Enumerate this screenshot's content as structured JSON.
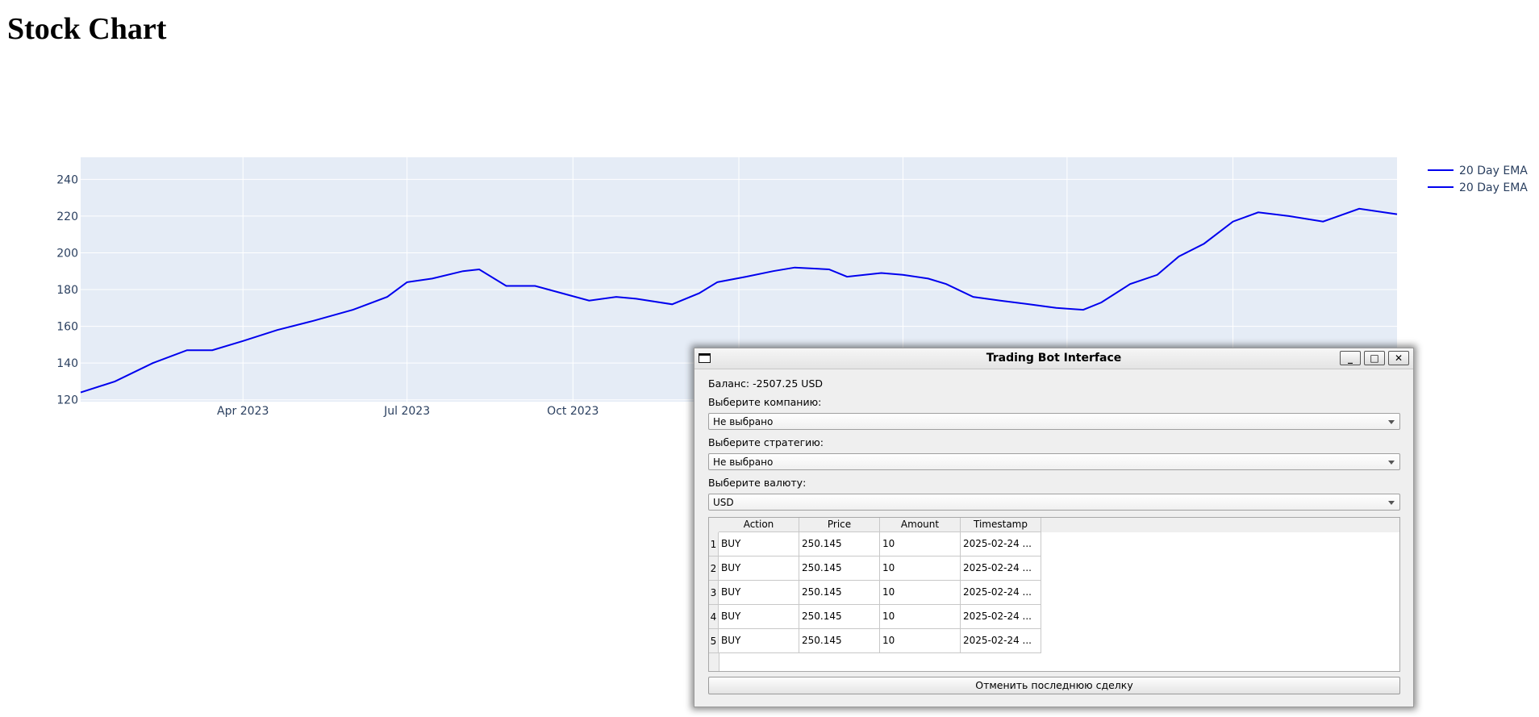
{
  "page": {
    "title": "Stock Chart"
  },
  "chart_data": {
    "type": "line",
    "legend": {
      "entries": [
        "20 Day EMA",
        "20 Day EMA"
      ],
      "placement": "top-right"
    },
    "x_ticks": [
      "Apr 2023",
      "Jul 2023",
      "Oct 2023"
    ],
    "y_ticks": [
      120,
      140,
      160,
      180,
      200,
      220,
      240
    ],
    "ylim": [
      119,
      252
    ],
    "xlim": [
      "2023-01-01",
      "2024-12-31"
    ],
    "grid": true,
    "colors": {
      "line": "#0000ee",
      "plot_bg": "#e5ecf6",
      "grid": "#ffffff",
      "tick_text": "#2a3f5f"
    },
    "series": [
      {
        "name": "20 Day EMA",
        "x": [
          "2023-01-01",
          "2023-01-20",
          "2023-02-10",
          "2023-03-01",
          "2023-03-15",
          "2023-04-01",
          "2023-04-20",
          "2023-05-10",
          "2023-06-01",
          "2023-06-20",
          "2023-07-01",
          "2023-07-15",
          "2023-08-01",
          "2023-08-10",
          "2023-08-25",
          "2023-09-10",
          "2023-09-25",
          "2023-10-10",
          "2023-10-25",
          "2023-11-05",
          "2023-11-25",
          "2023-12-10",
          "2023-12-20",
          "2024-01-05",
          "2024-01-20",
          "2024-02-01",
          "2024-02-20",
          "2024-03-01",
          "2024-03-20",
          "2024-04-01",
          "2024-04-15",
          "2024-04-25",
          "2024-05-10",
          "2024-05-25",
          "2024-06-10",
          "2024-06-25",
          "2024-07-10",
          "2024-07-20",
          "2024-08-05",
          "2024-08-20",
          "2024-09-01",
          "2024-09-15",
          "2024-10-01",
          "2024-10-15",
          "2024-11-01",
          "2024-11-20",
          "2024-12-10",
          "2024-12-31"
        ],
        "y": [
          124,
          130,
          140,
          147,
          147,
          152,
          158,
          163,
          169,
          176,
          184,
          186,
          190,
          191,
          182,
          182,
          178,
          174,
          176,
          175,
          172,
          178,
          184,
          187,
          190,
          192,
          191,
          187,
          189,
          188,
          186,
          183,
          176,
          174,
          172,
          170,
          169,
          173,
          183,
          188,
          198,
          205,
          217,
          222,
          220,
          217,
          224,
          221
        ]
      }
    ]
  },
  "window": {
    "title": "Trading Bot Interface",
    "buttons": {
      "minimize": "_",
      "maximize": "□",
      "close": "✕"
    },
    "balance": "Баланс: -2507.25 USD",
    "company_label": "Выберите компанию:",
    "company_value": "Не выбрано",
    "strategy_label": "Выберите стратегию:",
    "strategy_value": "Не выбрано",
    "currency_label": "Выберите валюту:",
    "currency_value": "USD",
    "table": {
      "headers": [
        "Action",
        "Price",
        "Amount",
        "Timestamp"
      ],
      "rows": [
        {
          "index": "1",
          "action": "BUY",
          "price": "250.145",
          "amount": "10",
          "timestamp": "2025-02-24 ..."
        },
        {
          "index": "2",
          "action": "BUY",
          "price": "250.145",
          "amount": "10",
          "timestamp": "2025-02-24 ..."
        },
        {
          "index": "3",
          "action": "BUY",
          "price": "250.145",
          "amount": "10",
          "timestamp": "2025-02-24 ..."
        },
        {
          "index": "4",
          "action": "BUY",
          "price": "250.145",
          "amount": "10",
          "timestamp": "2025-02-24 ..."
        },
        {
          "index": "5",
          "action": "BUY",
          "price": "250.145",
          "amount": "10",
          "timestamp": "2025-02-24 ..."
        }
      ]
    },
    "cancel_button": "Отменить последнюю сделку"
  }
}
